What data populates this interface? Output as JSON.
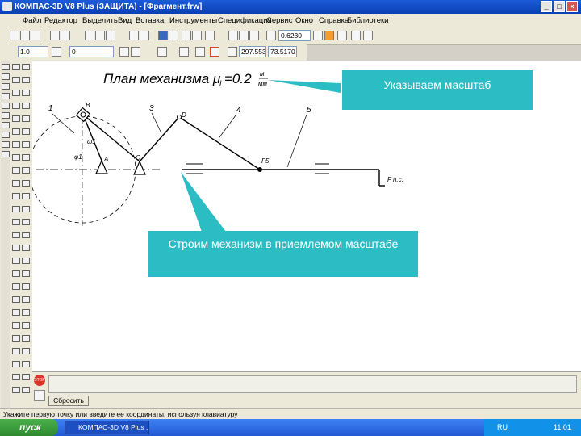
{
  "window": {
    "title": "КОМПАС-3D V8 Plus (ЗАЩИТА) - [Фрагмент.frw]",
    "controls": [
      "_",
      "□",
      "×"
    ]
  },
  "menu": {
    "items": [
      "Файл",
      "Редактор",
      "Выделить",
      "Вид",
      "Вставка",
      "Инструменты",
      "Спецификация",
      "Сервис",
      "Окно",
      "Справка",
      "Библиотеки"
    ]
  },
  "toolbar": {
    "scale_value": "0.6230",
    "style_value": "1.0",
    "layer_value": "0",
    "coords_x": "297.553",
    "coords_y": "73.5170"
  },
  "drawing": {
    "title": "План механизма μ",
    "title_subscript": "l",
    "title_value": "=0.2",
    "title_fraction_num": "м",
    "title_fraction_den": "мм",
    "labels": {
      "l1": "1",
      "l2": "2",
      "l3": "3",
      "l4": "4",
      "l5": "5",
      "B": "B",
      "A": "A",
      "C": "C",
      "D": "D",
      "F": "F",
      "F5": "F5",
      "Fps": "F п.с.",
      "phi1": "φ1",
      "omega1": "ω1"
    }
  },
  "callouts": {
    "scale": "Указываем масштаб",
    "mechanism": "Строим механизм в приемлемом масштабе"
  },
  "command": {
    "button": "Сбросить",
    "stop": "STOP"
  },
  "status": {
    "text": "Укажите первую точку или введите ее координаты, используя клавиатуру"
  },
  "taskbar": {
    "start": "пуск",
    "task": "КОМПАС-3D V8 Plus ...",
    "lang": "RU",
    "clock": "11:01"
  },
  "colors": {
    "titlebar": "#0a3fb5",
    "callout": "#2bbcc4",
    "taskbar": "#2358d3",
    "start": "#3c9a3c"
  }
}
